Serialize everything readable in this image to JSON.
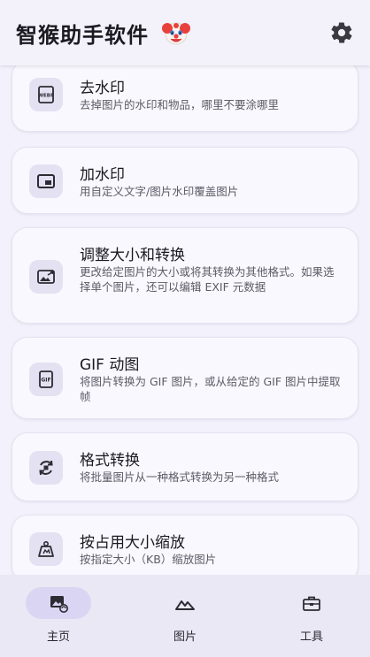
{
  "app": {
    "title": "智猴助手软件"
  },
  "header": {
    "settings_icon": "gear-icon",
    "logo_icon": "clown-face-icon"
  },
  "cards": [
    {
      "title": "去水印",
      "desc": "去掉图片的水印和物品，哪里不要涂哪里",
      "icon": "webp-icon"
    },
    {
      "title": "加水印",
      "desc": "用自定义文字/图片水印覆盖图片",
      "icon": "picture-in-picture-icon"
    },
    {
      "title": "调整大小和转换",
      "desc": "更改给定图片的大小或将其转换为其他格式。如果选择单个图片，还可以编辑 EXIF 元数据",
      "icon": "photo-resize-icon"
    },
    {
      "title": "GIF 动图",
      "desc": "将图片转换为 GIF 图片，或从给定的 GIF 图片中提取帧",
      "icon": "gif-icon"
    },
    {
      "title": "格式转换",
      "desc": "将批量图片从一种格式转换为另一种格式",
      "icon": "cycle-icon"
    },
    {
      "title": "按占用大小缩放",
      "desc": "按指定大小（KB）缩放图片",
      "icon": "weight-icon"
    }
  ],
  "nav": {
    "home": "主页",
    "images": "图片",
    "tools": "工具"
  },
  "colors": {
    "background": "#f3f1fb",
    "card": "#f9f8fe",
    "icon_bg": "#e4e1f2",
    "nav_active": "#d9d5f2"
  }
}
